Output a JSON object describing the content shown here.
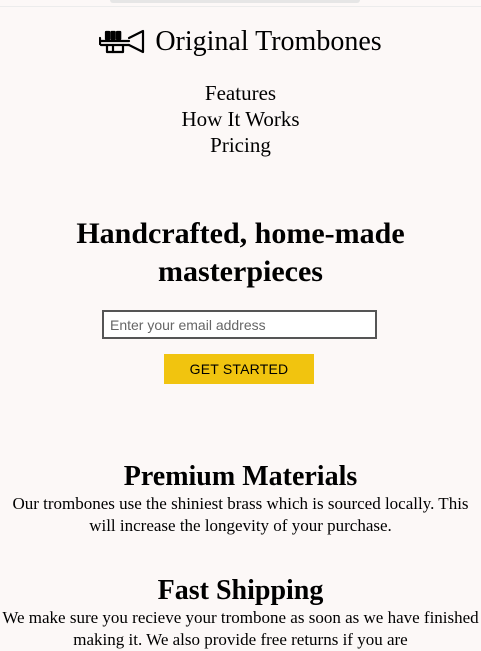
{
  "header": {
    "logo_icon": "trumpet-icon",
    "brand": "Original Trombones"
  },
  "nav": {
    "items": [
      {
        "label": "Features"
      },
      {
        "label": "How It Works"
      },
      {
        "label": "Pricing"
      }
    ]
  },
  "hero": {
    "title": "Handcrafted, home-made masterpieces",
    "email_placeholder": "Enter your email address",
    "email_value": "",
    "cta_label": "GET STARTED",
    "cta_color": "#f1c40f"
  },
  "features": [
    {
      "title": "Premium Materials",
      "description": "Our trombones use the shiniest brass which is sourced locally. This will increase the longevity of your purchase."
    },
    {
      "title": "Fast Shipping",
      "description": "We make sure you recieve your trombone as soon as we have finished making it. We also provide free returns if you are"
    }
  ],
  "colors": {
    "page_background": "#fcf8f7",
    "text": "#000000"
  }
}
